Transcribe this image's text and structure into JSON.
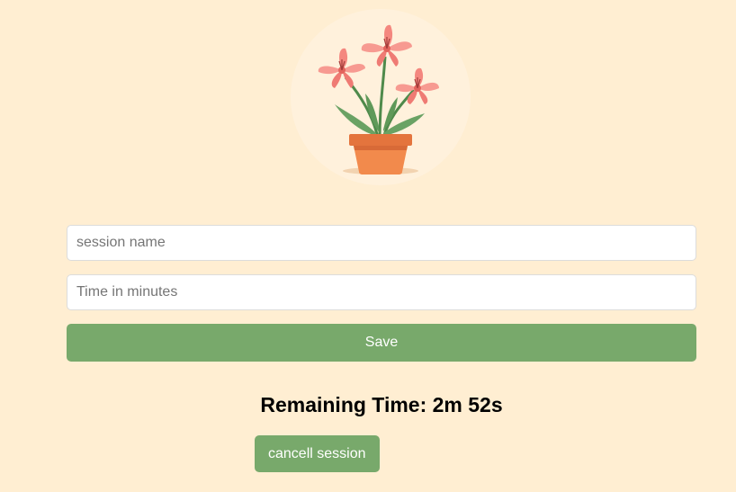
{
  "hero": {
    "image": "potted-flowering-plant-illustration"
  },
  "form": {
    "session_name_placeholder": "session name",
    "time_placeholder": "Time in minutes",
    "save_label": "Save"
  },
  "timer": {
    "remaining_text": "Remaining Time: 2m 52s"
  },
  "actions": {
    "cancel_label": "cancell session"
  },
  "colors": {
    "background": "#ffeed2",
    "button": "#78a96b",
    "button_text": "#ffffff"
  }
}
